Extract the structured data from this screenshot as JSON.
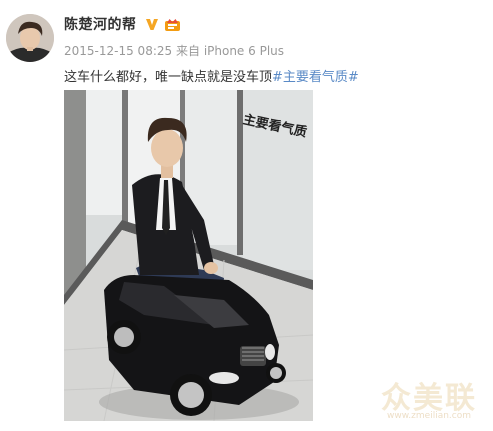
{
  "post": {
    "username": "陈楚河的帮",
    "timestamp": "2015-12-15 08:25",
    "source_prefix": "来自",
    "source": "iPhone 6 Plus",
    "text": "这车什么都好，唯一缺点就是没车顶",
    "hashtag": "#主要看气质#",
    "hashtag_color": "#5a8ac6"
  },
  "photo": {
    "sticker_text": "主要看气质"
  },
  "watermark": {
    "text": "众美联",
    "sub": "www.zmeilian.com"
  }
}
